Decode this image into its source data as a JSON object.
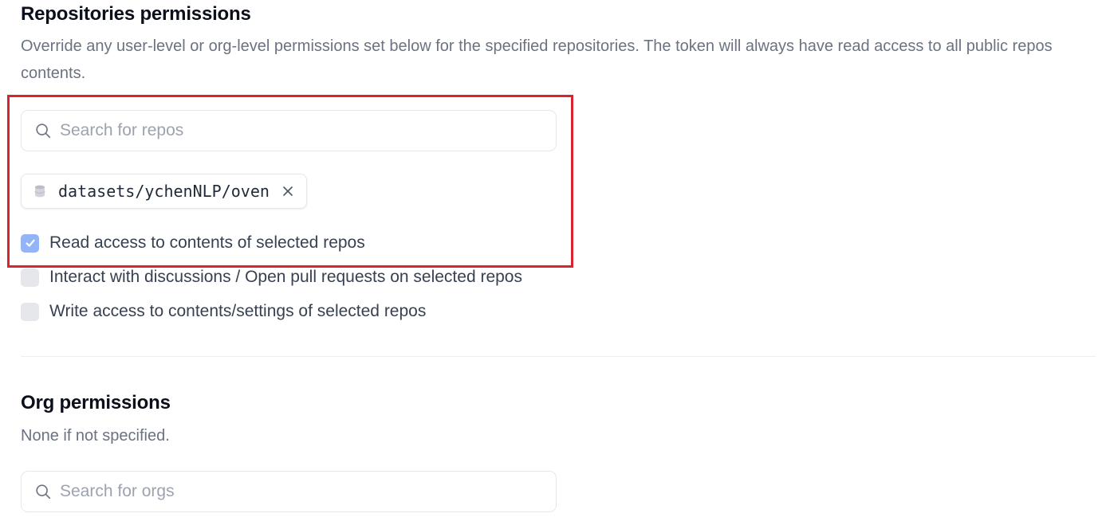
{
  "repos_section": {
    "title": "Repositories permissions",
    "description": "Override any user-level or org-level permissions set below for the specified repositories. The token will always have read access to all public repos contents.",
    "search": {
      "placeholder": "Search for repos",
      "value": ""
    },
    "selected_repo": {
      "label": "datasets/ychenNLP/oven",
      "icon": "database-icon"
    },
    "permissions": [
      {
        "label": "Read access to contents of selected repos",
        "checked": true
      },
      {
        "label": "Interact with discussions / Open pull requests on selected repos",
        "checked": false
      },
      {
        "label": "Write access to contents/settings of selected repos",
        "checked": false
      }
    ]
  },
  "org_section": {
    "title": "Org permissions",
    "description": "None if not specified.",
    "search": {
      "placeholder": "Search for orgs",
      "value": ""
    }
  },
  "colors": {
    "highlight": "#d9232e",
    "checkbox_checked": "#93b4f7",
    "checkbox_unchecked": "#e5e7eb"
  }
}
